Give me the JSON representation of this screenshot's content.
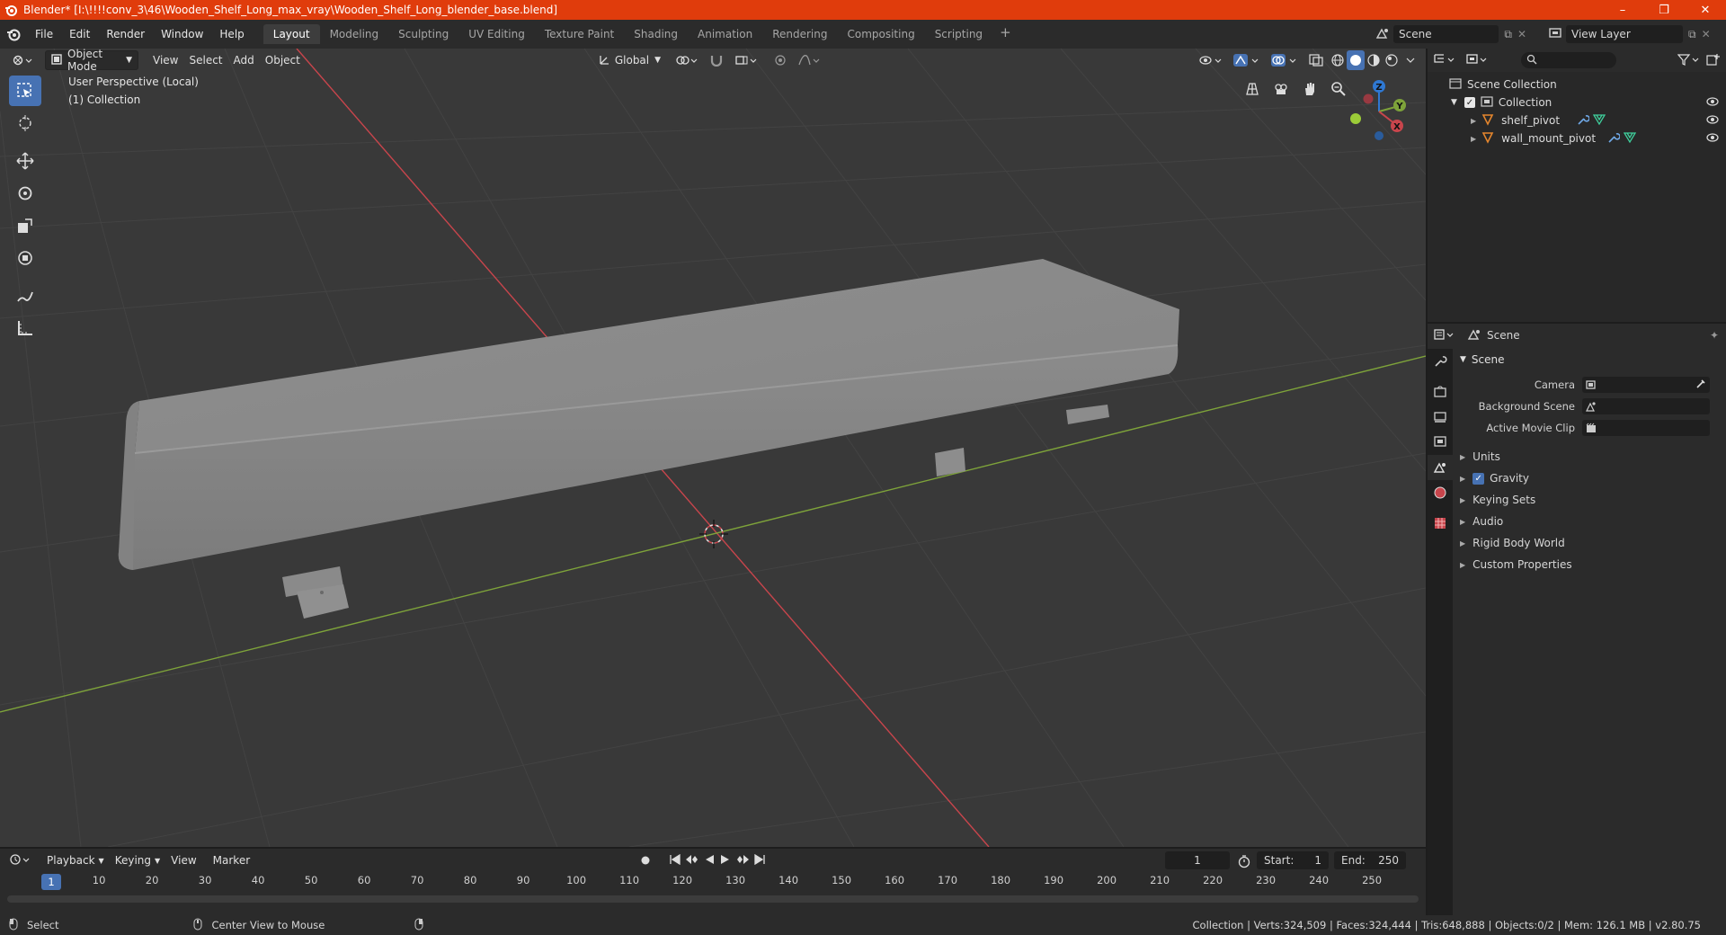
{
  "window": {
    "title": "Blender* [I:\\!!!!conv_3\\46\\Wooden_Shelf_Long_max_vray\\Wooden_Shelf_Long_blender_base.blend]"
  },
  "menubar": {
    "items": [
      "File",
      "Edit",
      "Render",
      "Window",
      "Help"
    ],
    "workspaces": [
      "Layout",
      "Modeling",
      "Sculpting",
      "UV Editing",
      "Texture Paint",
      "Shading",
      "Animation",
      "Rendering",
      "Compositing",
      "Scripting"
    ],
    "active_workspace": "Layout",
    "scene": "Scene",
    "view_layer": "View Layer"
  },
  "viewport": {
    "mode": "Object Mode",
    "menus": [
      "View",
      "Select",
      "Add",
      "Object"
    ],
    "transform_orientation": "Global",
    "perspective_label": "User Perspective (Local)",
    "collection_label": "(1) Collection",
    "gizmo_axes": [
      "X",
      "Y",
      "Z"
    ]
  },
  "outliner": {
    "root": "Scene Collection",
    "collection": "Collection",
    "objects": [
      "shelf_pivot",
      "wall_mount_pivot"
    ]
  },
  "properties": {
    "header": "Scene",
    "panel": "Scene",
    "fields": [
      {
        "label": "Camera",
        "value": ""
      },
      {
        "label": "Background Scene",
        "value": ""
      },
      {
        "label": "Active Movie Clip",
        "value": ""
      }
    ],
    "subpanels": [
      "Units",
      "Gravity",
      "Keying Sets",
      "Audio",
      "Rigid Body World",
      "Custom Properties"
    ],
    "gravity_checked": true
  },
  "timeline": {
    "menus": [
      "Playback",
      "Keying",
      "View",
      "Marker"
    ],
    "current_frame": "1",
    "start_label": "Start:",
    "start": "1",
    "end_label": "End:",
    "end": "250",
    "ticks": [
      "10",
      "20",
      "30",
      "40",
      "50",
      "60",
      "70",
      "80",
      "90",
      "100",
      "110",
      "120",
      "130",
      "140",
      "150",
      "160",
      "170",
      "180",
      "190",
      "200",
      "210",
      "220",
      "230",
      "240",
      "250"
    ],
    "cursor_frame": "1"
  },
  "statusbar": {
    "left_action": "Select",
    "middle_action": "Center View to Mouse",
    "stats": "Collection | Verts:324,509 | Faces:324,444 | Tris:648,888 | Objects:0/2 | Mem: 126.1 MB | v2.80.75"
  },
  "colors": {
    "title_bar": "#e03c0c",
    "accent": "#4772b3",
    "x_axis": "#c8454c",
    "y_axis": "#7ea33a",
    "z_axis": "#2f78d2"
  }
}
